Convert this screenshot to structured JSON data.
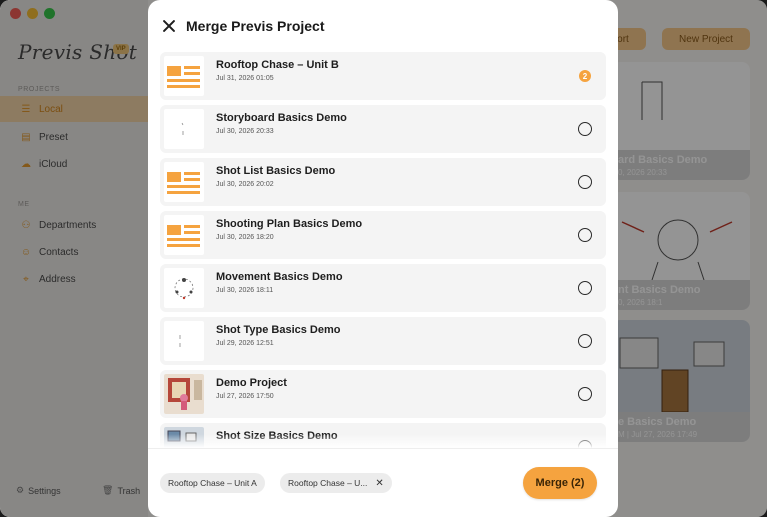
{
  "window": {
    "traffic_colors": [
      "#f25e57",
      "#f6bd34",
      "#37c74a"
    ]
  },
  "sidebar": {
    "logo": "Previs Shot",
    "badge": "VIP",
    "projects_header": "PROJECTS",
    "projects": [
      {
        "label": "Local",
        "icon": "list-icon",
        "active": true
      },
      {
        "label": "Preset",
        "icon": "folder-icon",
        "active": false
      },
      {
        "label": "iCloud",
        "icon": "cloud-icon",
        "active": false
      }
    ],
    "me_header": "ME",
    "me": [
      {
        "label": "Departments",
        "icon": "people-icon"
      },
      {
        "label": "Contacts",
        "icon": "person-icon"
      },
      {
        "label": "Address",
        "icon": "pin-icon"
      }
    ],
    "settings_label": "Settings",
    "trash_label": "Trash"
  },
  "toolbar": {
    "import_label": "ort",
    "new_project_label": "New Project"
  },
  "background_cards": [
    {
      "title": "ard Basics Demo",
      "meta": "0, 2026 20:33"
    },
    {
      "title": "nt Basics Demo",
      "meta": "0, 2026 18:1"
    },
    {
      "title": "e Basics Demo",
      "meta": "M | Jul 27, 2026 17:49"
    }
  ],
  "modal": {
    "title": "Merge Previs Project",
    "close_icon": "close-icon",
    "accent_color": "#f5a33f",
    "projects": [
      {
        "name": "Rooftop Chase – Unit B",
        "date": "Jul 31, 2026 01:05",
        "thumb": "document-icon",
        "selected": true,
        "order": "2"
      },
      {
        "name": "Storyboard Basics Demo",
        "date": "Jul 30, 2026 20:33",
        "thumb": "sketch",
        "selected": false,
        "order": ""
      },
      {
        "name": "Shot List Basics Demo",
        "date": "Jul 30, 2026 20:02",
        "thumb": "document-icon",
        "selected": false,
        "order": ""
      },
      {
        "name": "Shooting Plan Basics Demo",
        "date": "Jul 30, 2026 18:20",
        "thumb": "document-icon",
        "selected": false,
        "order": ""
      },
      {
        "name": "Movement Basics Demo",
        "date": "Jul 30, 2026 18:11",
        "thumb": "diagram",
        "selected": false,
        "order": ""
      },
      {
        "name": "Shot Type Basics Demo",
        "date": "Jul 29, 2026 12:51",
        "thumb": "sketch",
        "selected": false,
        "order": ""
      },
      {
        "name": "Demo Project",
        "date": "Jul 27, 2026 17:50",
        "thumb": "photo",
        "selected": false,
        "order": ""
      },
      {
        "name": "Shot Size Basics Demo",
        "date": "",
        "thumb": "scene",
        "selected": false,
        "order": ""
      }
    ],
    "chips": [
      {
        "label": "Rooftop Chase – Unit A",
        "removable": false
      },
      {
        "label": "Rooftop Chase – U...",
        "removable": true
      }
    ],
    "merge_label": "Merge (2)"
  }
}
